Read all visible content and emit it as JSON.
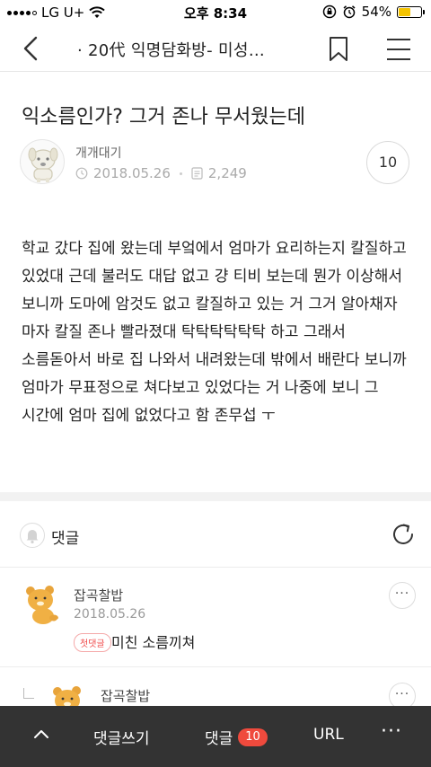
{
  "status_bar": {
    "carrier": "LG U+",
    "time": "오후 8:34",
    "battery": "54%",
    "battery_level": 0.54
  },
  "nav": {
    "title": "· 20代 익명담화방- 미성…"
  },
  "post": {
    "title": "익소름인가? 그거 존나 무서웠는데",
    "author": "개개대기",
    "date": "2018.05.26",
    "views": "2,249",
    "comment_count": "10",
    "body": "학교 갔다 집에 왔는데 부엌에서 엄마가 요리하는지 칼질하고 있었대 근데 불러도 대답 없고 걍 티비 보는데 뭔가 이상해서 보니까 도마에 암것도 없고 칼질하고 있는 거 그거 알아채자 마자 칼질 존나 빨라졌대 탁탁탁탁탁탁 하고 그래서 소름돋아서 바로 집 나와서 내려왔는데 밖에서 배란다 보니까 엄마가 무표정으로 쳐다보고 있었다는 거 나중에 보니 그 시간에 엄마 집에 없었다고 함 존무섭 ㅜ"
  },
  "comments_section": {
    "label": "댓글",
    "items": [
      {
        "name": "잡곡찰밥",
        "date": "2018.05.26",
        "badge": "첫댓글",
        "text": "미친 소름끼쳐",
        "more": "···"
      },
      {
        "name": "잡곡찰밥",
        "more": "···"
      }
    ]
  },
  "toolbar": {
    "write_label": "댓글쓰기",
    "comments_label": "댓글",
    "comments_count": "10",
    "url_label": "URL",
    "more_label": "···"
  }
}
